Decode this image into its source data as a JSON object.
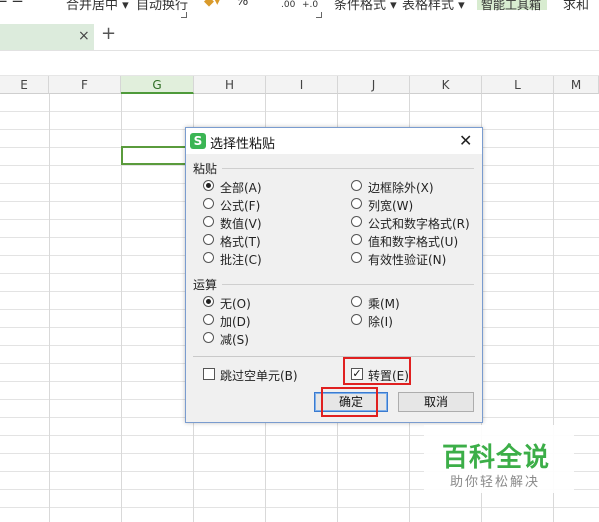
{
  "ribbon": {
    "merge_center": "合并居中",
    "auto_wrap": "自动换行",
    "percent": "%",
    "dec_decrease": ".00",
    "dec_increase": "+.0",
    "table_style": "表格样式",
    "smart_toolbox": "智能工具箱",
    "partial_right": "求和"
  },
  "tabbar": {
    "close_glyph": "×",
    "add_glyph": "+"
  },
  "columns": [
    "E",
    "F",
    "G",
    "H",
    "I",
    "J",
    "K",
    "L",
    "M"
  ],
  "selected_column": "G",
  "dialog": {
    "title": "选择性粘贴",
    "logo_letter": "S",
    "close_glyph": "✕",
    "paste_group": "粘贴",
    "paste_left": [
      {
        "label": "全部(A)",
        "checked": true
      },
      {
        "label": "公式(F)",
        "checked": false
      },
      {
        "label": "数值(V)",
        "checked": false
      },
      {
        "label": "格式(T)",
        "checked": false
      },
      {
        "label": "批注(C)",
        "checked": false
      }
    ],
    "paste_right": [
      {
        "label": "边框除外(X)",
        "checked": false
      },
      {
        "label": "列宽(W)",
        "checked": false
      },
      {
        "label": "公式和数字格式(R)",
        "checked": false
      },
      {
        "label": "值和数字格式(U)",
        "checked": false
      },
      {
        "label": "有效性验证(N)",
        "checked": false
      }
    ],
    "operation_group": "运算",
    "op_left": [
      {
        "label": "无(O)",
        "checked": true
      },
      {
        "label": "加(D)",
        "checked": false
      },
      {
        "label": "减(S)",
        "checked": false
      }
    ],
    "op_right": [
      {
        "label": "乘(M)",
        "checked": false
      },
      {
        "label": "除(I)",
        "checked": false
      }
    ],
    "skip_blanks": {
      "label": "跳过空单元(B)",
      "checked": false
    },
    "transpose": {
      "label": "转置(E)",
      "checked": true,
      "mark": "✓"
    },
    "ok_label": "确定",
    "cancel_label": "取消"
  },
  "watermark": {
    "title": "百科全说",
    "subtitle": "助你轻松解决"
  },
  "colors": {
    "accent_green": "#3bb554",
    "highlight_red": "#e02020",
    "selection_green": "#5a9b3c"
  }
}
